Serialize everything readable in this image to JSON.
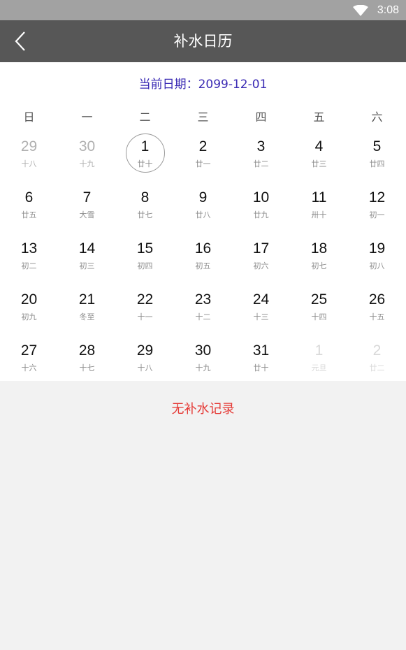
{
  "status": {
    "time": "3:08"
  },
  "header": {
    "title": "补水日历"
  },
  "calendar": {
    "current_date_label": "当前日期：2099-12-01",
    "weekdays": [
      "日",
      "一",
      "二",
      "三",
      "四",
      "五",
      "六"
    ],
    "weeks": [
      [
        {
          "day": "29",
          "lunar": "十八",
          "type": "prev"
        },
        {
          "day": "30",
          "lunar": "十九",
          "type": "prev"
        },
        {
          "day": "1",
          "lunar": "廿十",
          "type": "current",
          "selected": true
        },
        {
          "day": "2",
          "lunar": "廿一",
          "type": "current"
        },
        {
          "day": "3",
          "lunar": "廿二",
          "type": "current"
        },
        {
          "day": "4",
          "lunar": "廿三",
          "type": "current"
        },
        {
          "day": "5",
          "lunar": "廿四",
          "type": "current"
        }
      ],
      [
        {
          "day": "6",
          "lunar": "廿五",
          "type": "current"
        },
        {
          "day": "7",
          "lunar": "大雪",
          "type": "current"
        },
        {
          "day": "8",
          "lunar": "廿七",
          "type": "current"
        },
        {
          "day": "9",
          "lunar": "廿八",
          "type": "current"
        },
        {
          "day": "10",
          "lunar": "廿九",
          "type": "current"
        },
        {
          "day": "11",
          "lunar": "卅十",
          "type": "current"
        },
        {
          "day": "12",
          "lunar": "初一",
          "type": "current"
        }
      ],
      [
        {
          "day": "13",
          "lunar": "初二",
          "type": "current"
        },
        {
          "day": "14",
          "lunar": "初三",
          "type": "current"
        },
        {
          "day": "15",
          "lunar": "初四",
          "type": "current"
        },
        {
          "day": "16",
          "lunar": "初五",
          "type": "current"
        },
        {
          "day": "17",
          "lunar": "初六",
          "type": "current"
        },
        {
          "day": "18",
          "lunar": "初七",
          "type": "current"
        },
        {
          "day": "19",
          "lunar": "初八",
          "type": "current"
        }
      ],
      [
        {
          "day": "20",
          "lunar": "初九",
          "type": "current"
        },
        {
          "day": "21",
          "lunar": "冬至",
          "type": "current"
        },
        {
          "day": "22",
          "lunar": "十一",
          "type": "current"
        },
        {
          "day": "23",
          "lunar": "十二",
          "type": "current"
        },
        {
          "day": "24",
          "lunar": "十三",
          "type": "current"
        },
        {
          "day": "25",
          "lunar": "十四",
          "type": "current"
        },
        {
          "day": "26",
          "lunar": "十五",
          "type": "current"
        }
      ],
      [
        {
          "day": "27",
          "lunar": "十六",
          "type": "current"
        },
        {
          "day": "28",
          "lunar": "十七",
          "type": "current"
        },
        {
          "day": "29",
          "lunar": "十八",
          "type": "current"
        },
        {
          "day": "30",
          "lunar": "十九",
          "type": "current"
        },
        {
          "day": "31",
          "lunar": "廿十",
          "type": "current"
        },
        {
          "day": "1",
          "lunar": "元旦",
          "type": "next"
        },
        {
          "day": "2",
          "lunar": "廿二",
          "type": "next"
        }
      ]
    ]
  },
  "records": {
    "empty_message": "无补水记录"
  },
  "icons": {
    "back": "chevron-left-icon",
    "wifi": "wifi-icon"
  },
  "colors": {
    "app_bar": "#575757",
    "status_bar": "#a2a2a2",
    "date_label": "#3b2bb4",
    "empty_message": "#e53935"
  }
}
